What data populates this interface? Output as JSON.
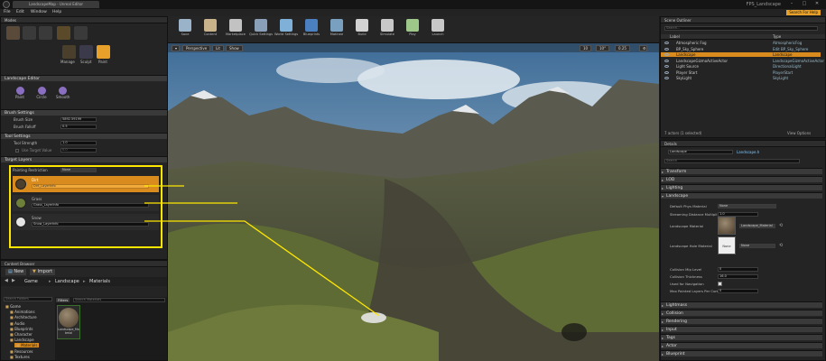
{
  "window": {
    "tab": "LandscapeMap - Unreal Editor",
    "project": "FPS_Landscape",
    "minimize": "–",
    "maximize": "□",
    "close": "✕"
  },
  "menu": {
    "items": [
      "File",
      "Edit",
      "Window",
      "Help"
    ],
    "search_badge": "Search For Help"
  },
  "modes": {
    "tab": "Modes",
    "tools": [
      {
        "label": "Manage"
      },
      {
        "label": "Sculpt"
      },
      {
        "label": "Paint"
      }
    ]
  },
  "landscape_editor": {
    "section": "Landscape Editor",
    "tools": [
      "Paint",
      "Circle",
      "Smooth"
    ],
    "brush_settings": {
      "section": "Brush Settings",
      "size_label": "Brush Size",
      "size_value": "5892.59199",
      "falloff_label": "Brush Falloff",
      "falloff_value": "0.5"
    },
    "tool_settings": {
      "section": "Tool Settings",
      "strength_label": "Tool Strength",
      "strength_value": "1.0",
      "target_label": "Use Target Value",
      "target_value": "0.0"
    },
    "target_layers": {
      "section": "Target Layers",
      "restriction_label": "Painting Restriction",
      "restriction_value": "None",
      "layers": [
        {
          "name": "Dirt",
          "file": "Dirt_LayerInfo"
        },
        {
          "name": "Grass",
          "file": "Grass_LayerInfo"
        },
        {
          "name": "Snow",
          "file": "Snow_LayerInfo"
        }
      ]
    }
  },
  "content_browser": {
    "tab": "Content Browser",
    "new_label": "New",
    "import_label": "Import",
    "path": [
      "Game",
      "Landscape",
      "Materials"
    ],
    "folder_search_placeholder": "Search Folders",
    "filters_label": "Filters",
    "asset_search_placeholder": "Search Materials",
    "folders": [
      "Game",
      "Animations",
      "Architecture",
      "Audio",
      "Blueprints",
      "Character",
      "Landscape",
      "Materials",
      "Resources",
      "Textures"
    ],
    "asset": "Landscape_Material"
  },
  "toolbar": {
    "buttons": [
      "Save",
      "Content",
      "Marketplace",
      "Quick Settings",
      "World Settings",
      "Blueprints",
      "Matinee",
      "Build",
      "Simulate",
      "Play",
      "Launch"
    ]
  },
  "viewport": {
    "perspective": "Perspective",
    "lit": "Lit",
    "show": "Show",
    "grid_value": "10",
    "angle_value": "10°",
    "scale_value": "0.25"
  },
  "outliner": {
    "tab": "Scene Outliner",
    "search_placeholder": "Search...",
    "col_label": "Label",
    "col_type": "Type",
    "rows": [
      {
        "name": "Atmospheric Fog",
        "type": "AtmosphericFog"
      },
      {
        "name": "BP_Sky_Sphere",
        "type": "Edit BP_Sky_Sphere"
      },
      {
        "name": "Landscape",
        "type": "Landscape"
      },
      {
        "name": "LandscapeGizmoActiveActor",
        "type": "LandscapeGizmoActiveActor"
      },
      {
        "name": "Light Source",
        "type": "DirectionalLight"
      },
      {
        "name": "Player Start",
        "type": "PlayerStart"
      },
      {
        "name": "SkyLight",
        "type": "SkyLight"
      }
    ],
    "status": "7 actors (1 selected)",
    "view_options": "View Options"
  },
  "details": {
    "tab": "Details",
    "name_value": "Landscape",
    "class_link": "Landscape.h",
    "search_placeholder": "Search",
    "sections_top": [
      "Transform",
      "LOD",
      "Lighting",
      "Landscape"
    ],
    "props": [
      {
        "label": "Default Phys Material",
        "value": "None"
      },
      {
        "label": "Streaming Distance Multipli",
        "value": "1.0"
      },
      {
        "label": "Landscape Material",
        "value": "Landscape_Material"
      },
      {
        "label": "Landscape Hole Material",
        "value": "None"
      },
      {
        "label": "Collision Mip Level",
        "value": "0"
      },
      {
        "label": "Collision Thickness",
        "value": "16.0"
      },
      {
        "label": "Used for Navigation",
        "value": ""
      },
      {
        "label": "Max Painted Layers Per Com",
        "value": "0"
      }
    ],
    "thumb_none": "None",
    "sections_bottom": [
      "Lightmass",
      "Collision",
      "Rendering",
      "Input",
      "Tags",
      "Actor",
      "Blueprint"
    ]
  },
  "colors": {
    "accent": "#e7a12b",
    "highlight_box": "#ffe600",
    "selected_row": "#d98b1e"
  }
}
